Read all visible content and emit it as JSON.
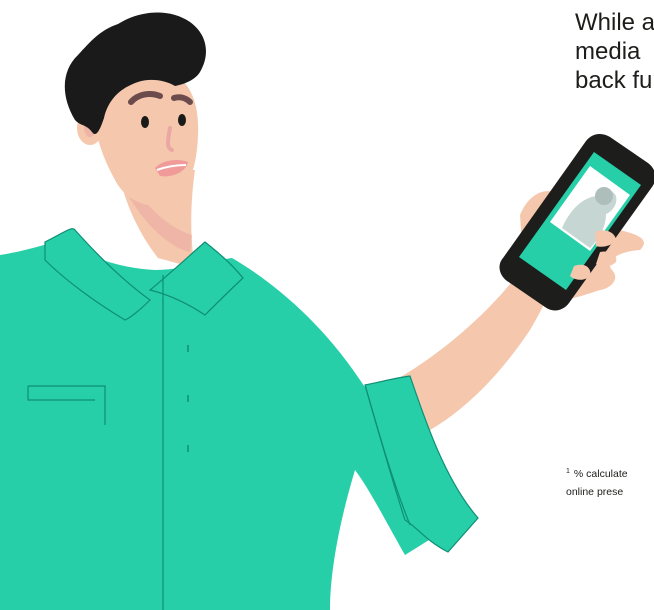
{
  "headline": {
    "line1": "While a",
    "line2": "media",
    "line3": "back fu"
  },
  "footnote": {
    "marker": "1",
    "line1": "% calculate",
    "line2": "online prese"
  },
  "colors": {
    "shirt": "#26cfa8",
    "shirt_outline": "#0e8f75",
    "skin": "#f5c8ae",
    "hair": "#1a1a1a",
    "phone_body": "#1d1d1b",
    "phone_screen": "#26cfa8",
    "lips": "#f09a9a",
    "text": "#1d1d1b"
  },
  "icons": [
    "man-illustration",
    "smartphone-illustration",
    "profile-photo-icon"
  ]
}
